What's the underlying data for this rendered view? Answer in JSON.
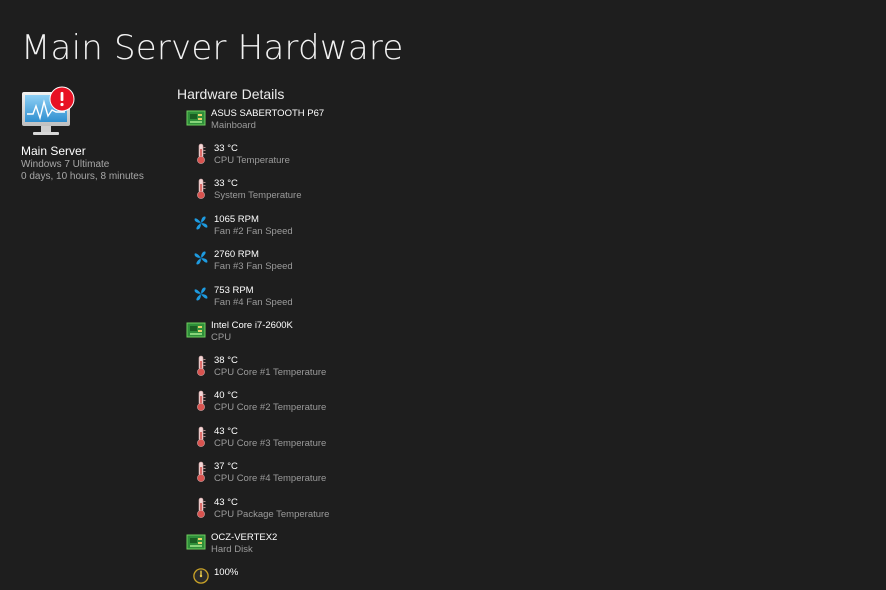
{
  "page": {
    "title": "Main Server Hardware"
  },
  "server": {
    "name": "Main Server",
    "os": "Windows 7 Ultimate",
    "uptime": "0 days, 10 hours, 8 minutes",
    "alert_color": "#e81123"
  },
  "details": {
    "header": "Hardware Details",
    "groups": [
      {
        "device": {
          "name": "ASUS SABERTOOTH P67",
          "type": "Mainboard",
          "icon": "circuit-board-icon"
        },
        "sensors": [
          {
            "value": "33 °C",
            "label": "CPU Temperature",
            "icon": "thermometer-icon"
          },
          {
            "value": "33 °C",
            "label": "System Temperature",
            "icon": "thermometer-icon"
          },
          {
            "value": "1065 RPM",
            "label": "Fan #2 Fan Speed",
            "icon": "fan-icon"
          },
          {
            "value": "2760 RPM",
            "label": "Fan #3 Fan Speed",
            "icon": "fan-icon"
          },
          {
            "value": "753 RPM",
            "label": "Fan #4 Fan Speed",
            "icon": "fan-icon"
          }
        ]
      },
      {
        "device": {
          "name": "Intel Core i7-2600K",
          "type": "CPU",
          "icon": "circuit-board-icon"
        },
        "sensors": [
          {
            "value": "38 °C",
            "label": "CPU Core #1 Temperature",
            "icon": "thermometer-icon"
          },
          {
            "value": "40 °C",
            "label": "CPU Core #2 Temperature",
            "icon": "thermometer-icon"
          },
          {
            "value": "43 °C",
            "label": "CPU Core #3 Temperature",
            "icon": "thermometer-icon"
          },
          {
            "value": "37 °C",
            "label": "CPU Core #4 Temperature",
            "icon": "thermometer-icon"
          },
          {
            "value": "43 °C",
            "label": "CPU Package Temperature",
            "icon": "thermometer-icon"
          }
        ]
      },
      {
        "device": {
          "name": "OCZ-VERTEX2",
          "type": "Hard Disk",
          "icon": "circuit-board-icon"
        },
        "sensors": [
          {
            "value": "100%",
            "label": "",
            "icon": "gauge-icon"
          }
        ]
      }
    ]
  },
  "colors": {
    "background": "#1e1e1e",
    "fan_blue": "#1e9be0",
    "board_green": "#3a9a3a",
    "thermo_red": "#d9534f"
  }
}
